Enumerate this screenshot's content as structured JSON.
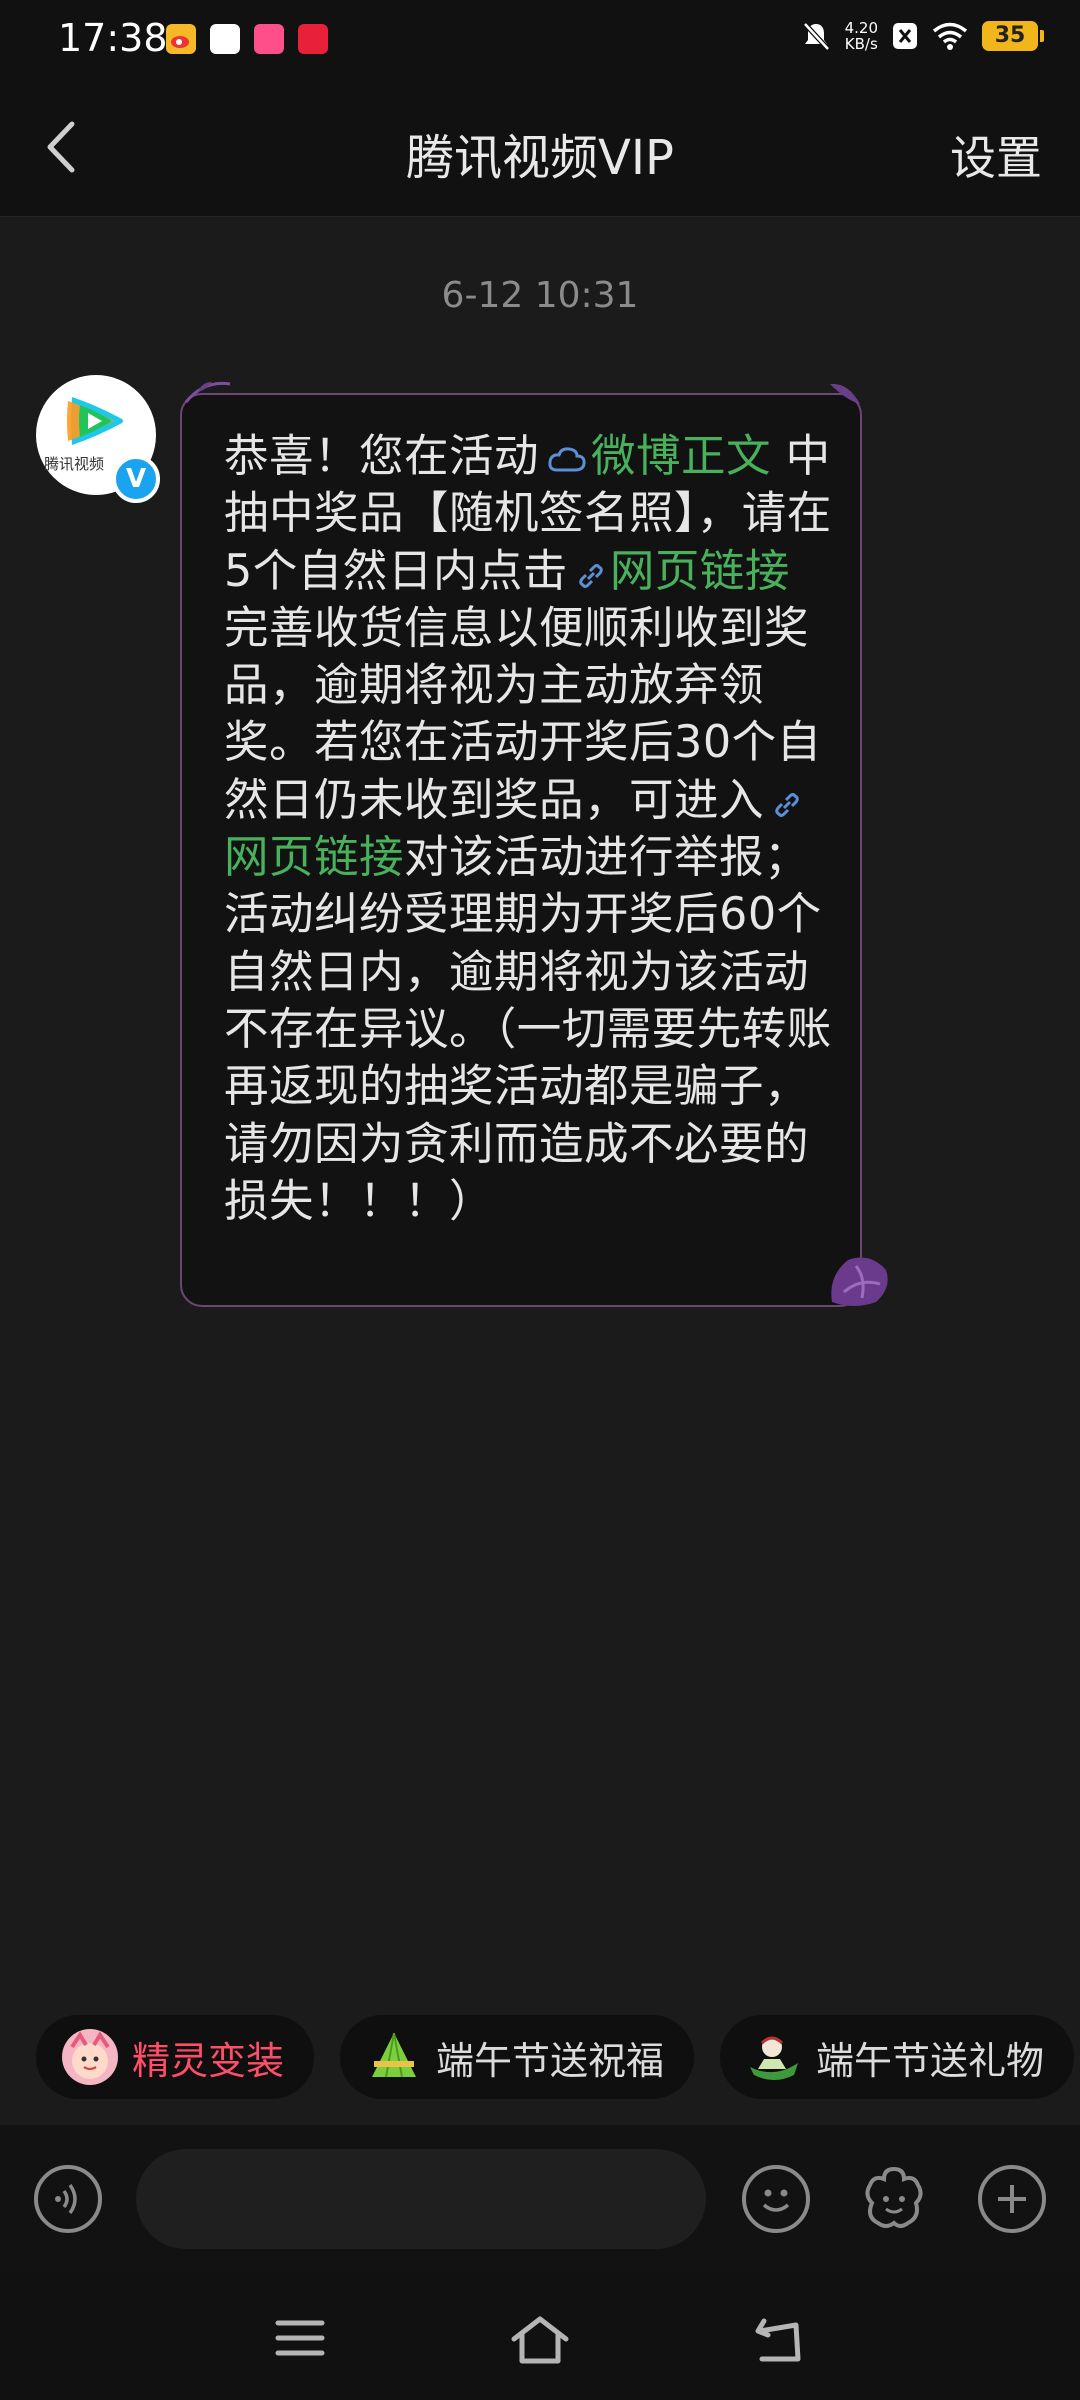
{
  "status_bar": {
    "time": "17:38",
    "net_speed_value": "4.20",
    "net_speed_unit": "KB/s",
    "battery": "35",
    "icons": [
      "weibo-app-icon",
      "white-app-icon",
      "pink-app-icon",
      "red-app-icon",
      "mute-icon",
      "close-box-icon",
      "wifi-icon",
      "battery-icon"
    ]
  },
  "header": {
    "title": "腾讯视频VIP",
    "settings": "设置"
  },
  "chat": {
    "timestamp": "6-12 10:31",
    "avatar_label": "腾讯视频",
    "verified_mark": "V",
    "message": {
      "part1": "恭喜！您在活动",
      "link1": "微博正文",
      "part2": " 中抽中奖品【随机签名照】，请在5个自然日内点击",
      "link2": "网页链接",
      "part3": " 完善收货信息以便顺利收到奖品，逾期将视为主动放弃领奖。若您在活动开奖后30个自然日仍未收到奖品，可进入",
      "link3": "网页链接",
      "part4": "对该活动进行举报；活动纠纷受理期为开奖后60个自然日内，逾期将视为该活动不存在异议。（一切需要先转账再返现的抽奖活动都是骗子，请勿因为贪利而造成不必要的损失！！！）"
    }
  },
  "quick_replies": [
    {
      "label": "精灵变装",
      "color": "#ff4d6a"
    },
    {
      "label": "端午节送祝福",
      "color": "#dcdcdc"
    },
    {
      "label": "端午节送礼物",
      "color": "#dcdcdc"
    }
  ],
  "input": {
    "placeholder": "",
    "buttons": [
      "voice-icon",
      "emoji-icon",
      "sticker-icon",
      "plus-icon"
    ]
  },
  "nav": [
    "menu-icon",
    "home-icon",
    "back-icon"
  ]
}
